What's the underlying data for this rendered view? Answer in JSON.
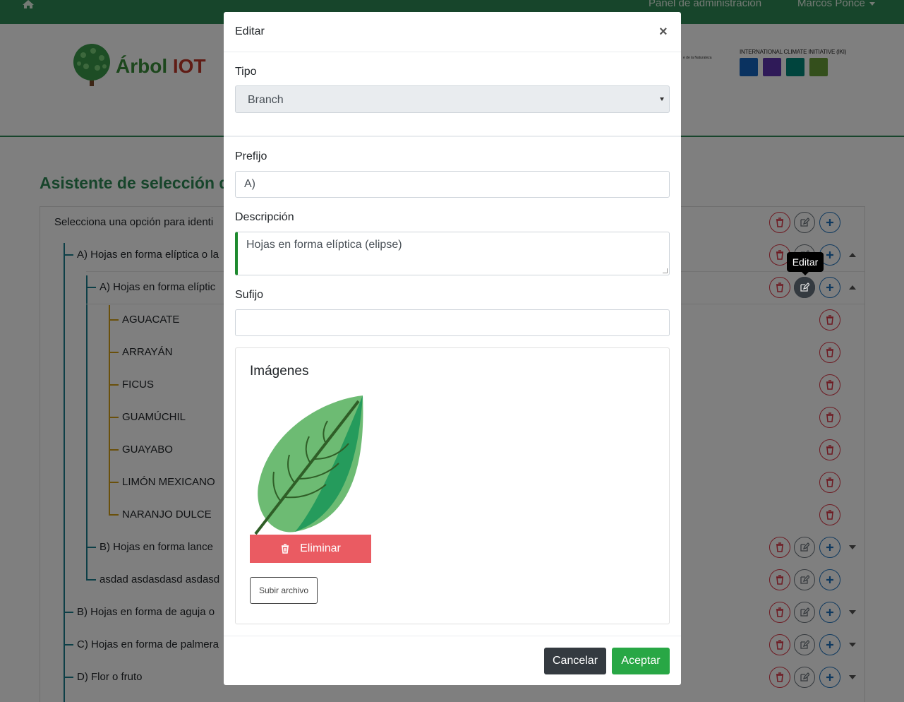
{
  "topbar": {
    "admin_link": "Panel de administración",
    "user_name": "Marcos Ponce"
  },
  "logo": {
    "part1": "Árbol",
    "part2": "IOT"
  },
  "partners": {
    "tiny_text": "e de la Naturaleza",
    "iki_label": "INTERNATIONAL CLIMATE INITIATIVE (IKI)"
  },
  "page": {
    "title": "Asistente de selección d",
    "root_prompt": "Selecciona una opción para identi"
  },
  "tree": {
    "branch_a": "A) Hojas en forma elíptica o la",
    "branch_a_a": "A) Hojas en forma elíptic",
    "species": [
      "AGUACATE",
      "ARRAYÁN",
      "FICUS",
      "GUAMÚCHIL",
      "GUAYABO",
      "LIMÓN MEXICANO",
      "NARANJO DULCE"
    ],
    "branch_a_b": "B) Hojas en forma lance",
    "branch_a_c": "asdad asdasdasd asdasd",
    "branch_b": "B) Hojas en forma de aguja o",
    "branch_c": "C) Hojas en forma de palmera",
    "branch_d": "D) Flor o fruto"
  },
  "tooltip": "Editar",
  "modal": {
    "title": "Editar",
    "close": "×",
    "tipo_label": "Tipo",
    "tipo_value": "Branch",
    "prefijo_label": "Prefijo",
    "prefijo_value": "A)",
    "descripcion_label": "Descripción",
    "descripcion_value": "Hojas en forma elíptica (elipse)",
    "sufijo_label": "Sufijo",
    "sufijo_value": "",
    "images_title": "Imágenes",
    "delete_image_label": "Eliminar",
    "upload_label": "Subir archivo",
    "cancel_label": "Cancelar",
    "accept_label": "Aceptar"
  },
  "colors": {
    "brand_green": "#2e8b57",
    "danger": "#dc3545",
    "primary": "#1e73be",
    "success": "#28a745",
    "dark": "#343a40"
  }
}
